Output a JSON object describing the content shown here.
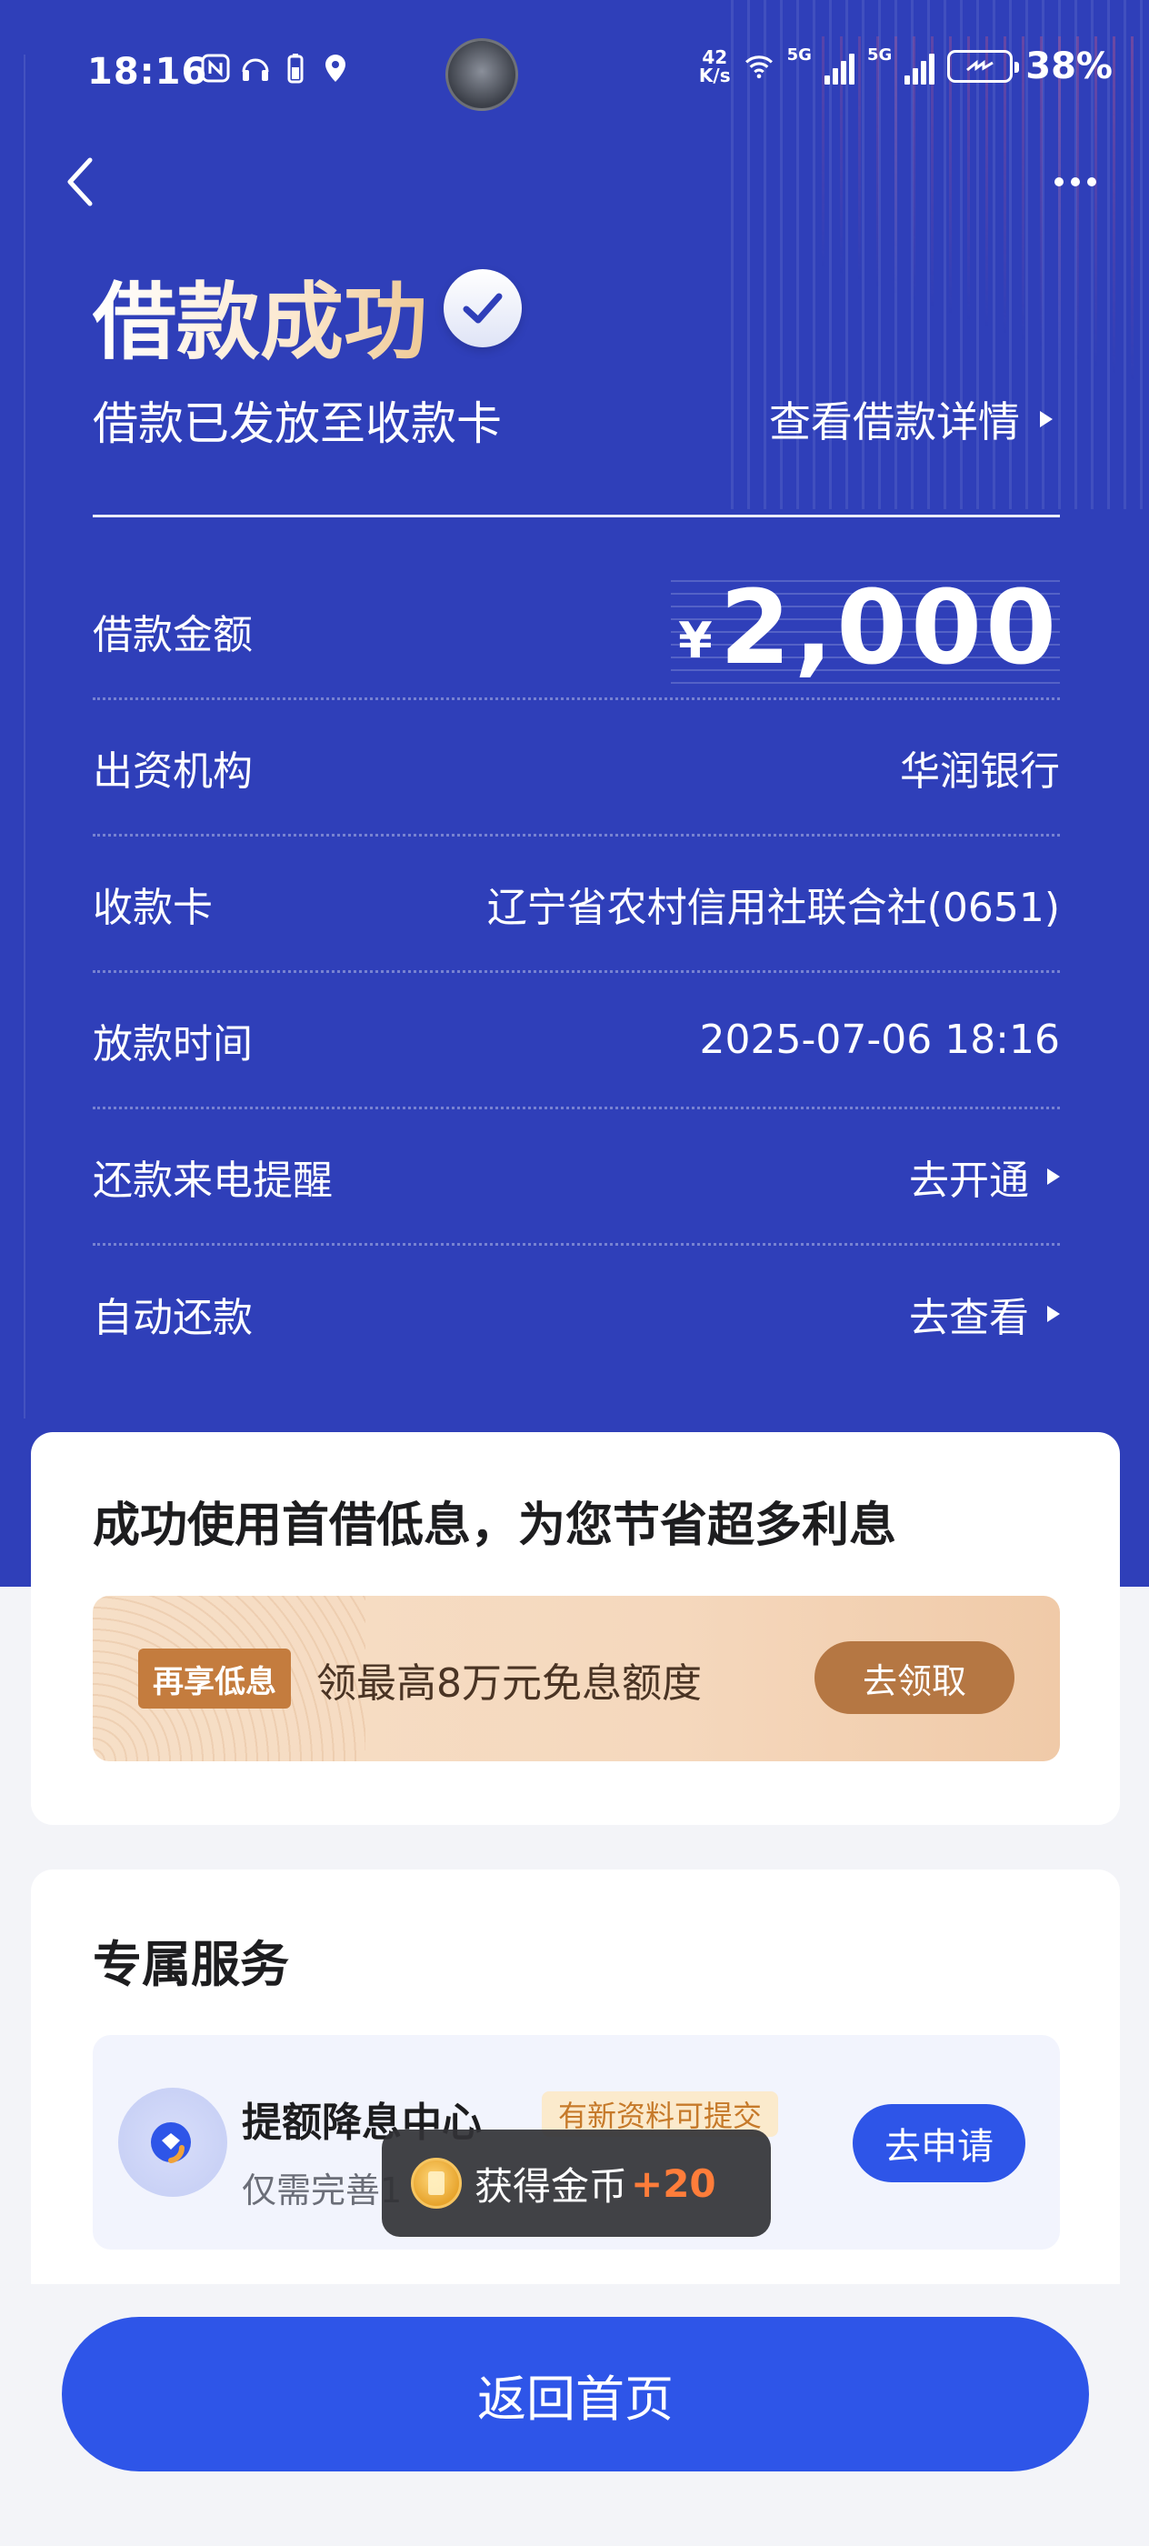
{
  "status_bar": {
    "time": "18:16",
    "net_speed_value": "42",
    "net_speed_unit": "K/s",
    "signal_1_label": "5G",
    "signal_2_label": "5G",
    "battery_pct": "38%"
  },
  "header": {
    "title": "借款成功",
    "subtitle": "借款已发放至收款卡",
    "detail_link": "查看借款详情"
  },
  "details": {
    "amount_label": "借款金额",
    "amount_currency": "¥",
    "amount_value": "2,000",
    "rows": [
      {
        "label": "出资机构",
        "value": "华润银行"
      },
      {
        "label": "收款卡",
        "value": "辽宁省农村信用社联合社(0651)"
      },
      {
        "label": "放款时间",
        "value": "2025-07-06 18:16"
      },
      {
        "label": "还款来电提醒",
        "value": "去开通"
      },
      {
        "label": "自动还款",
        "value": "去查看"
      }
    ]
  },
  "promo_card": {
    "title": "成功使用首借低息，为您节省超多利息",
    "tag": "再享低息",
    "text": "领最高8万元免息额度",
    "button": "去领取"
  },
  "service_card": {
    "title": "专属服务",
    "item": {
      "name": "提额降息中心",
      "badge": "有新资料可提交",
      "desc": "仅需完善1",
      "button": "去申请"
    }
  },
  "toast": {
    "text": "获得金币",
    "amount": "+20"
  },
  "bottom": {
    "home_button": "返回首页"
  },
  "colors": {
    "hero_bg": "#2f3fb9",
    "primary_button": "#2e55e8",
    "promo_button": "#b57743",
    "toast_amount": "#ff7d3a"
  }
}
